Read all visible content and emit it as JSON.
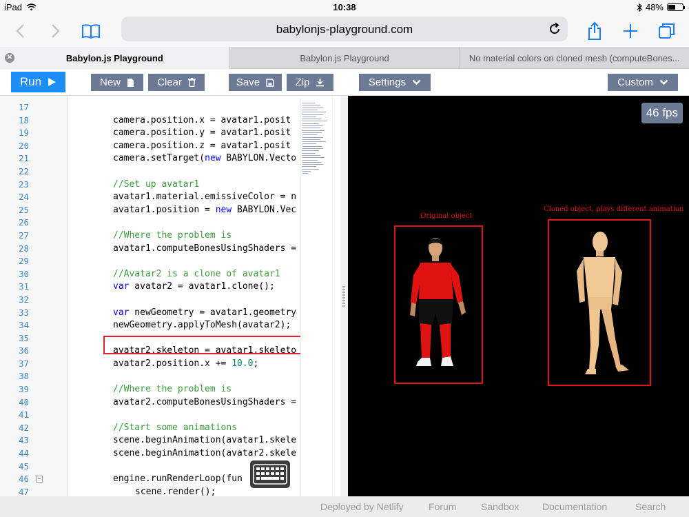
{
  "status_bar": {
    "device": "iPad",
    "time": "10:38",
    "battery": "48%",
    "battery_level": 0.48
  },
  "browser": {
    "url": "babylonjs-playground.com",
    "tabs": [
      {
        "label": "Babylon.js Playground",
        "active": true
      },
      {
        "label": "Babylon.js Playground",
        "active": false
      },
      {
        "label": "No material colors on cloned mesh (computeBones...",
        "active": false
      }
    ]
  },
  "toolbar": {
    "run": "Run",
    "new": "New",
    "clear": "Clear",
    "save": "Save",
    "zip": "Zip",
    "settings": "Settings",
    "custom": "Custom"
  },
  "editor": {
    "lines": [
      {
        "n": "17",
        "code": ""
      },
      {
        "n": "18",
        "code": "camera.position.x = avatar1.posit"
      },
      {
        "n": "19",
        "code": "camera.position.y = avatar1.posit"
      },
      {
        "n": "20",
        "code": "camera.position.z = avatar1.posit"
      },
      {
        "n": "21",
        "code": "camera.setTarget(new BABYLON.Vecto"
      },
      {
        "n": "22",
        "code": ""
      },
      {
        "n": "23",
        "code": "//Set up avatar1",
        "type": "comment"
      },
      {
        "n": "24",
        "code": "avatar1.material.emissiveColor = n"
      },
      {
        "n": "25",
        "code": "avatar1.position = new BABYLON.Vec"
      },
      {
        "n": "26",
        "code": ""
      },
      {
        "n": "27",
        "code": "//Where the problem is",
        "type": "comment"
      },
      {
        "n": "28",
        "code": "avatar1.computeBonesUsingShaders ="
      },
      {
        "n": "29",
        "code": ""
      },
      {
        "n": "30",
        "code": "//Avatar2 is a clone of avatar1",
        "type": "comment"
      },
      {
        "n": "31",
        "code": "var avatar2 = avatar1.clone();"
      },
      {
        "n": "32",
        "code": ""
      },
      {
        "n": "33",
        "code": "var newGeometry = avatar1.geometry"
      },
      {
        "n": "34",
        "code": "newGeometry.applyToMesh(avatar2);"
      },
      {
        "n": "35",
        "code": ""
      },
      {
        "n": "36",
        "code": "avatar2.skeleton = avatar1.skeleto"
      },
      {
        "n": "37",
        "code": "avatar2.position.x += 10.0;"
      },
      {
        "n": "38",
        "code": ""
      },
      {
        "n": "39",
        "code": "//Where the problem is",
        "type": "comment"
      },
      {
        "n": "40",
        "code": "avatar2.computeBonesUsingShaders ="
      },
      {
        "n": "41",
        "code": ""
      },
      {
        "n": "42",
        "code": "//Start some animations",
        "type": "comment"
      },
      {
        "n": "43",
        "code": "scene.beginAnimation(avatar1.skele"
      },
      {
        "n": "44",
        "code": "scene.beginAnimation(avatar2.skele"
      },
      {
        "n": "45",
        "code": ""
      },
      {
        "n": "46",
        "code": "engine.runRenderLoop(fun",
        "fold": true
      },
      {
        "n": "47",
        "code": "scene.render();",
        "indent": 2
      }
    ]
  },
  "viewport": {
    "fps": "46 fps",
    "label_original": "Original object",
    "label_clone": "Cloned object, plays different animation"
  },
  "footer": {
    "deployed": "Deployed by Netlify",
    "forum": "Forum",
    "sandbox": "Sandbox",
    "documentation": "Documentation",
    "search": "Search"
  },
  "colors": {
    "accent": "#1d8ef5",
    "button": "#6d7a96",
    "highlight": "#e01515"
  }
}
